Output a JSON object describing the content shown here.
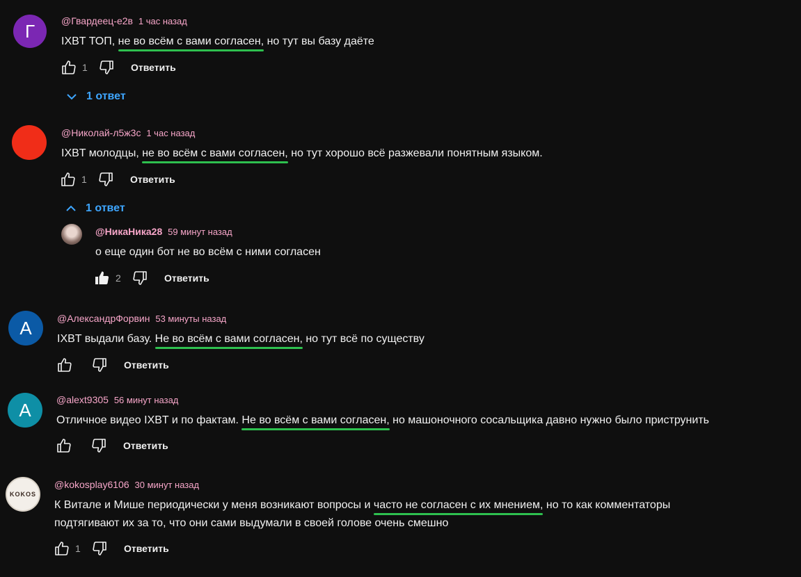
{
  "reply_label": "Ответить",
  "colors": {
    "background": "#0f0f0f",
    "author": "#f7a6c9",
    "link": "#3ea6ff",
    "highlight": "#2ec04f"
  },
  "comments": [
    {
      "avatar_letter": "Г",
      "avatar_color": "#7b27b3",
      "author": "@Гвардеец-е2в",
      "time": "1 час назад",
      "text_pre": "IXBT ТОП, ",
      "text_hl": "не во всём с вами согласен,",
      "text_post": " но тут вы базу даёте",
      "likes": "1",
      "replies_label": "1 ответ"
    },
    {
      "avatar_letter": "",
      "avatar_color": "#f02d18",
      "author": "@Николай-л5ж3с",
      "time": "1 час назад",
      "text_pre": "IXBT молодцы, ",
      "text_hl": "не во всём с вами согласен,",
      "text_post": " но тут хорошо всё разжевали понятным языком.",
      "likes": "1",
      "replies_label": "1 ответ",
      "reply": {
        "author": "@НикаНика28",
        "time": "59 минут назад",
        "text": "о еще один бот не во всём с ними согласен",
        "likes": "2"
      }
    },
    {
      "avatar_letter": "А",
      "avatar_color": "#0b5aa6",
      "author": "@АлександрФорвин",
      "time": "53 минуты назад",
      "text_pre": "IXBT выдали базу. ",
      "text_hl": "Не во всём с вами согласен,",
      "text_post": " но тут всё по существу",
      "likes": ""
    },
    {
      "avatar_letter": "А",
      "avatar_color": "#0e8fa6",
      "author": "@alext9305",
      "time": "56 минут назад",
      "text_pre": "Отличное видео IXBT и по фактам. ",
      "text_hl": "Не во всём с вами согласен,",
      "text_post": " но машоночного сосальщика давно нужно было приструнить",
      "likes": ""
    },
    {
      "avatar_letter": "KOKOS",
      "avatar_color": "#f3efe9",
      "author": "@kokosplay6106",
      "time": "30 минут назад",
      "text_pre": "К Витале и Мише периодически у меня возникают вопросы и ",
      "text_hl": "часто не согласен с их мнением,",
      "text_post": " но то как комментаторы",
      "text_line2": "подтягивают их за то, что они сами выдумали в своей голове очень смешно",
      "likes": "1"
    }
  ]
}
